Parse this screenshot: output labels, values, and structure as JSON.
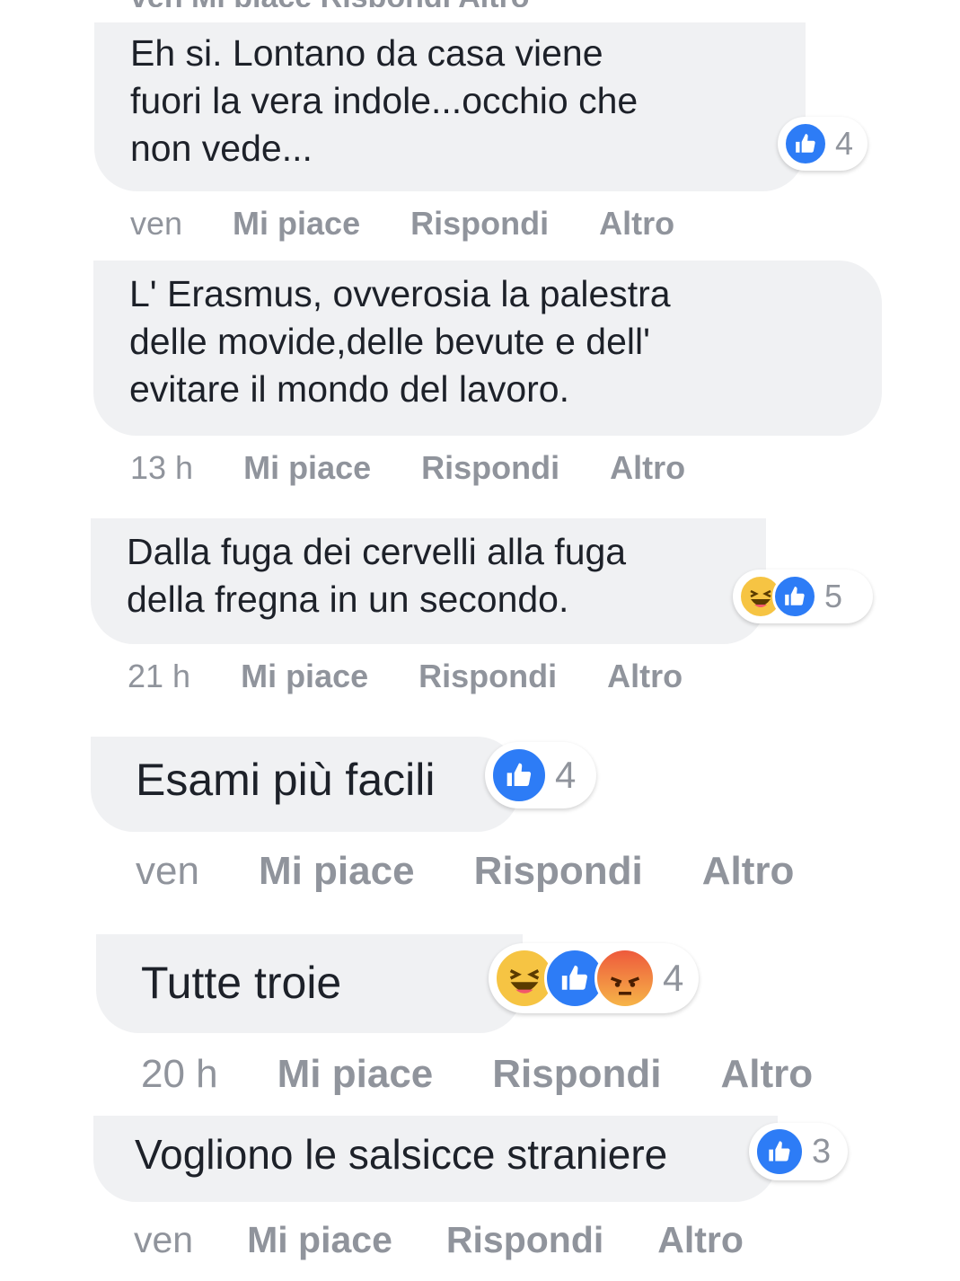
{
  "cut_top": "ven Mi piace Rispondi Altro",
  "colors": {
    "like": "#2d7cf6",
    "haha": "#f6c443",
    "angry": "#ee5a3c",
    "bubble": "#f0f1f3",
    "meta": "#90949c"
  },
  "comments": [
    {
      "text": "Eh si. Lontano da casa viene\nfuori la vera indole...occhio che\nnon vede...",
      "reactions": [
        "like"
      ],
      "reaction_count": "4",
      "time": "ven",
      "like": "Mi piace",
      "reply": "Rispondi",
      "more": "Altro"
    },
    {
      "text": "L' Erasmus, ovverosia la palestra\ndelle movide,delle bevute e dell'\nevitare il mondo del lavoro.",
      "reactions": [],
      "reaction_count": "",
      "time": "13 h",
      "like": "Mi piace",
      "reply": "Rispondi",
      "more": "Altro"
    },
    {
      "text": "Dalla fuga dei cervelli alla fuga\ndella fregna in un secondo.",
      "reactions": [
        "haha",
        "like"
      ],
      "reaction_count": "5",
      "time": "21 h",
      "like": "Mi piace",
      "reply": "Rispondi",
      "more": "Altro"
    },
    {
      "text": "Esami più facili",
      "reactions": [
        "like"
      ],
      "reaction_count": "4",
      "time": "ven",
      "like": "Mi piace",
      "reply": "Rispondi",
      "more": "Altro"
    },
    {
      "text": "Tutte troie",
      "reactions": [
        "haha",
        "like",
        "angry"
      ],
      "reaction_count": "4",
      "time": "20 h",
      "like": "Mi piace",
      "reply": "Rispondi",
      "more": "Altro"
    },
    {
      "text": "Vogliono le salsicce straniere",
      "reactions": [
        "like"
      ],
      "reaction_count": "3",
      "time": "ven",
      "like": "Mi piace",
      "reply": "Rispondi",
      "more": "Altro"
    }
  ]
}
